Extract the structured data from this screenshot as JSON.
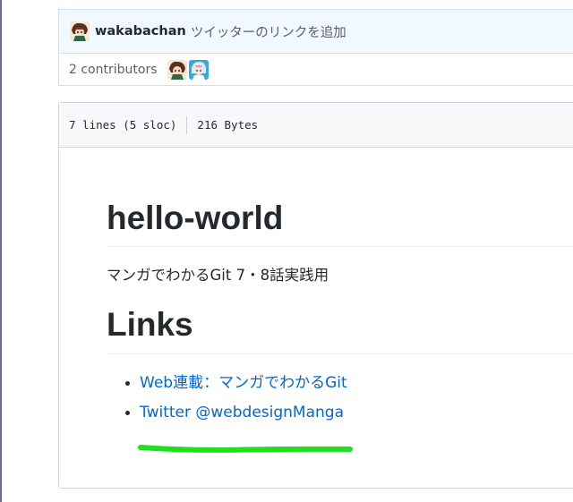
{
  "commit": {
    "author": "wakabachan",
    "message": "ツイッターのリンクを追加"
  },
  "contributors": {
    "label": "2 contributors"
  },
  "file": {
    "lines": "7 lines (5 sloc)",
    "size": "216 Bytes"
  },
  "readme": {
    "title": "hello-world",
    "description": "マンガでわかるGit 7・8話実践用",
    "links_heading": "Links",
    "links": [
      {
        "label": "Web連載：マンガでわかるGit"
      },
      {
        "label": "Twitter @webdesignManga"
      }
    ]
  },
  "annotation": {
    "highlight_color": "#1ee01e"
  }
}
